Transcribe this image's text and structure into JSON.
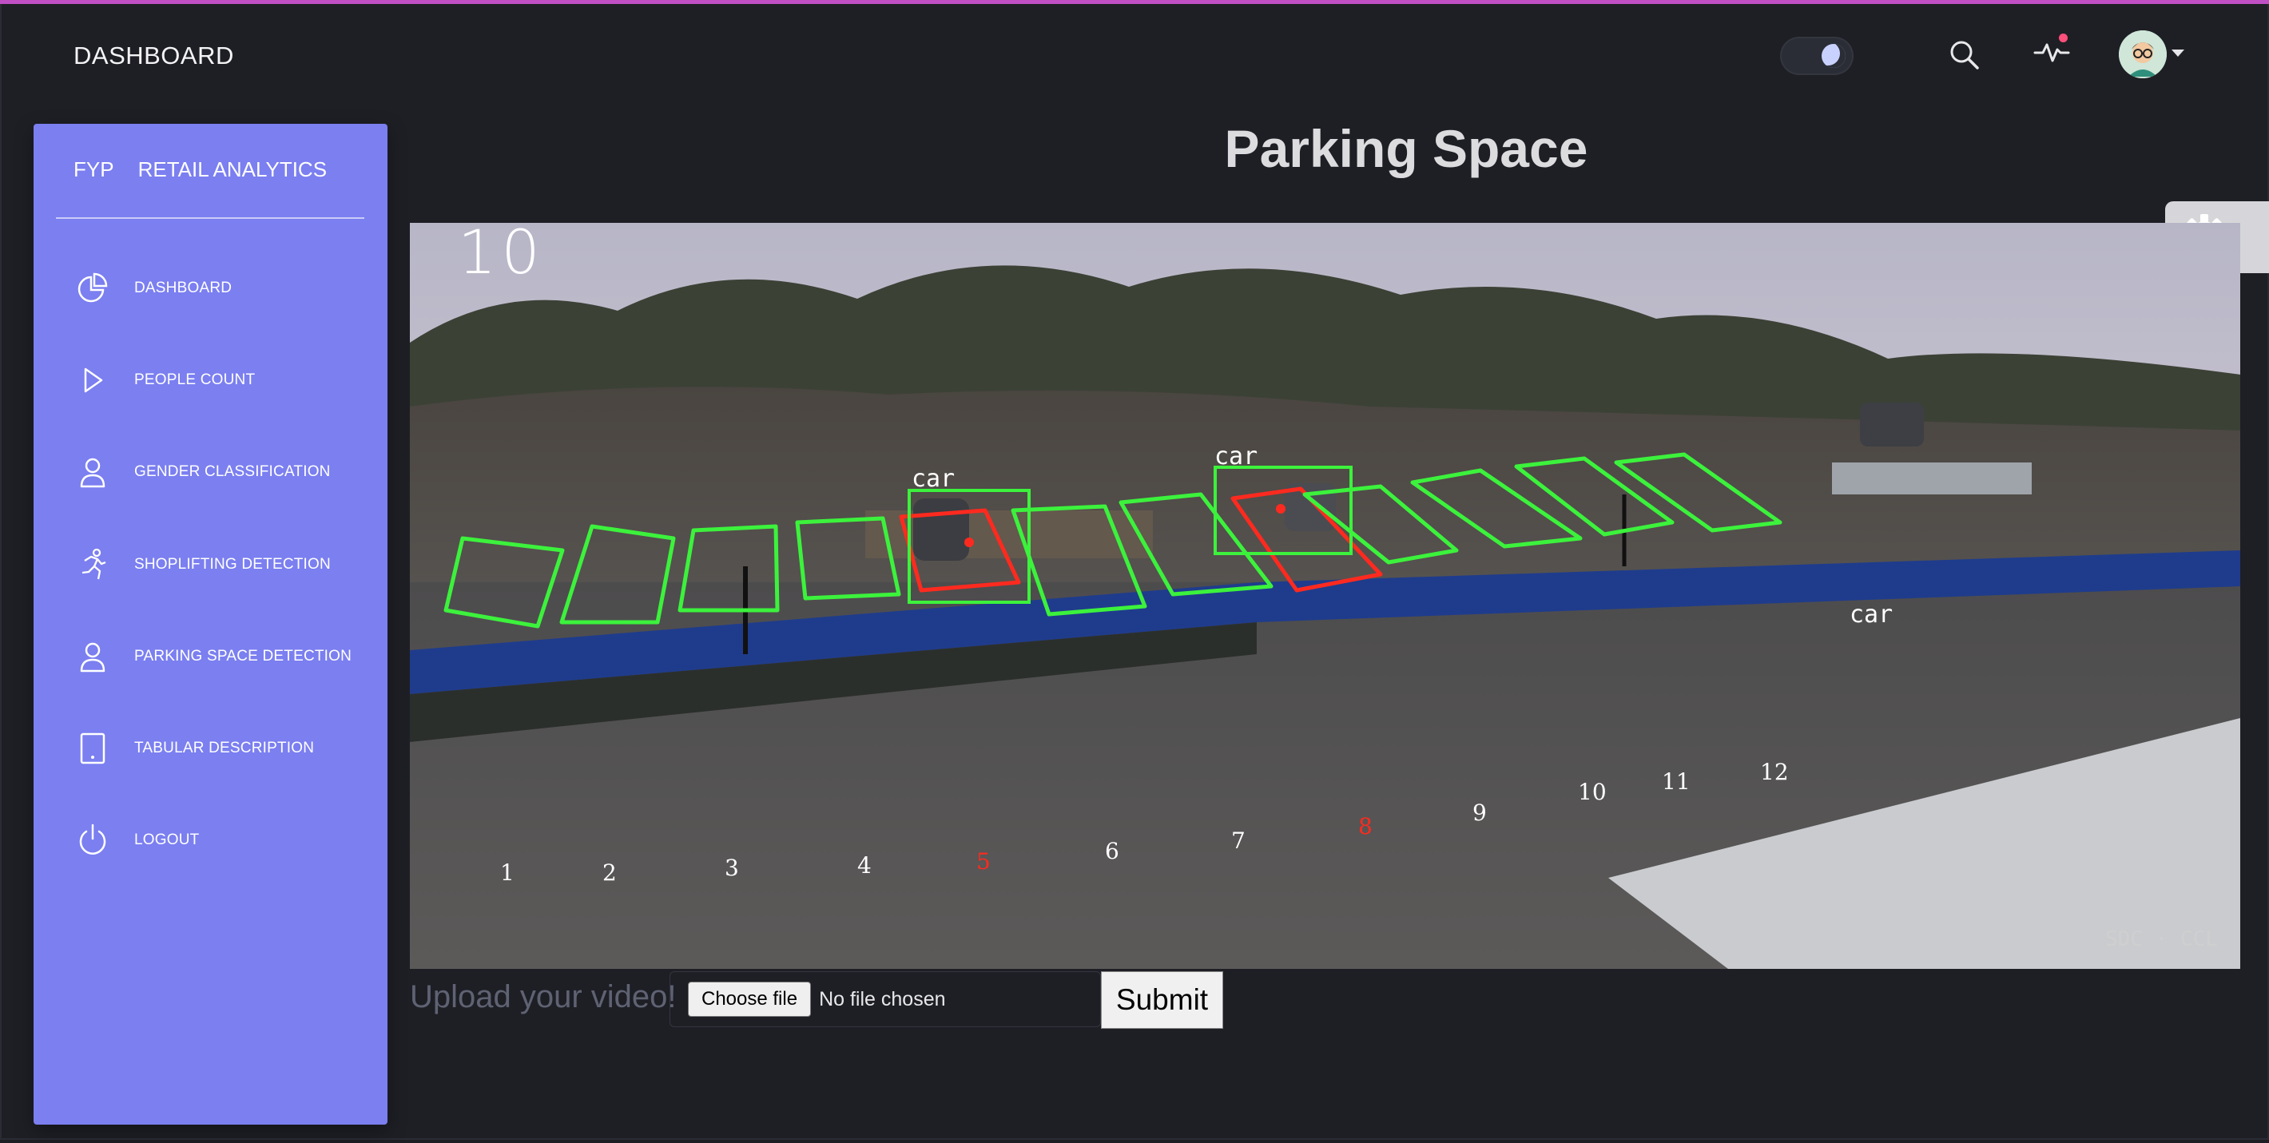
{
  "navbar": {
    "brand": "DASHBOARD",
    "theme_toggle_icon": "moon-icon",
    "search_icon": "search-icon",
    "activity_icon": "activity-icon",
    "avatar_icon": "avatar"
  },
  "sidebar": {
    "brand_short": "FYP",
    "brand_title": "RETAIL ANALYTICS",
    "items": [
      {
        "label": "DASHBOARD",
        "icon": "pie-chart-icon"
      },
      {
        "label": "PEOPLE COUNT",
        "icon": "play-icon"
      },
      {
        "label": "GENDER CLASSIFICATION",
        "icon": "user-icon"
      },
      {
        "label": "SHOPLIFTING DETECTION",
        "icon": "running-person-icon"
      },
      {
        "label": "PARKING SPACE DETECTION",
        "icon": "user-icon"
      },
      {
        "label": "TABULAR DESCRIPTION",
        "icon": "tablet-icon"
      },
      {
        "label": "LOGOUT",
        "icon": "power-icon"
      }
    ]
  },
  "main": {
    "title": "Parking Space",
    "video": {
      "frame_counter": "10",
      "watermark": "SDC · CCL",
      "detections": [
        "car",
        "car",
        "car"
      ],
      "spots": [
        {
          "label": "1",
          "status": "free"
        },
        {
          "label": "2",
          "status": "free"
        },
        {
          "label": "3",
          "status": "free"
        },
        {
          "label": "4",
          "status": "free"
        },
        {
          "label": "5",
          "status": "occupied"
        },
        {
          "label": "6",
          "status": "free"
        },
        {
          "label": "7",
          "status": "free"
        },
        {
          "label": "8",
          "status": "occupied"
        },
        {
          "label": "9",
          "status": "free"
        },
        {
          "label": "10",
          "status": "free"
        },
        {
          "label": "11",
          "status": "free"
        },
        {
          "label": "12",
          "status": "free"
        }
      ]
    },
    "upload": {
      "label": "Upload your video!",
      "choose_button": "Choose file",
      "file_status": "No file chosen",
      "submit_button": "Submit"
    }
  },
  "settings_icon": "gear-icon",
  "colors": {
    "background": "#1e1f25",
    "sidebar": "#7b7ff0",
    "accent_line": "#c04fc4",
    "free_spot": "#3cf23c",
    "occupied_spot": "#ff2a1f"
  }
}
